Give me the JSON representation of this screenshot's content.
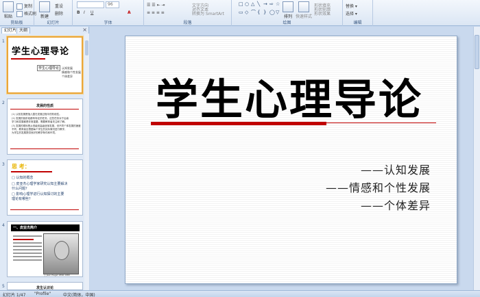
{
  "ribbon": {
    "clipboard": {
      "label": "剪贴板",
      "paste": "粘贴",
      "copy": "复制",
      "format_painter": "格式刷"
    },
    "slides": {
      "label": "幻灯片",
      "new_slide": "新建",
      "new_slide_sub": "幻灯片",
      "reset": "重设",
      "delete": "删除"
    },
    "font": {
      "label": "字体",
      "size": "96"
    },
    "paragraph": {
      "label": "段落",
      "text_direction": "文字方向",
      "align_text": "对齐文本",
      "smartart": "转换为 SmartArt"
    },
    "drawing": {
      "label": "绘图",
      "arrange": "排列",
      "quick_styles": "快速样式",
      "shape_fill": "形状填充",
      "shape_outline": "形状轮廓",
      "shape_effects": "形状效果"
    },
    "editing": {
      "label": "编辑",
      "replace": "替换",
      "select": "选择"
    }
  },
  "leftpane": {
    "tabs": [
      "幻灯片",
      "大纲"
    ],
    "slides": [
      {
        "num": "1",
        "title": "学生心理导论",
        "box": "学生心理导论",
        "items": [
          "认知发展",
          "情感和个性发展",
          "个体差异"
        ]
      },
      {
        "num": "2",
        "title": "发展的性质",
        "lines": [
          "(1) 认知发展是指儿童在发展过程中的阶段性。",
          "(2) 发展的各阶段都有特定的任务，这些任务对于后续",
          "    学习和发展都是非常重要，需要教育者关注和了解。",
          "(3) 发展的顺序是从低级到高级逐渐发展，但不同个体发展的速度",
          "    不同，教育者应根据每个学生的实际情况进行教学，",
          "    为学生的发展提供良好的教学条件和环境。"
        ]
      },
      {
        "num": "3",
        "head": "思 考：",
        "items": [
          "□ 认知的概念",
          "□ 皮亚杰心理学家研究认知主要解决",
          "      什么问题？",
          "□ 影响心理学进行认知探讨的主要",
          "      理论有哪些？"
        ]
      },
      {
        "num": "4",
        "band": "一、皮亚杰简介",
        "caption": "J. Jean Piaget  1896-1980"
      },
      {
        "num": "5",
        "title": "发生认识论"
      }
    ]
  },
  "slide": {
    "title": "学生心理导论",
    "subtitles": [
      "——认知发展",
      "——情感和个性发展",
      "——个体差异"
    ]
  },
  "status": {
    "slide_info": "幻灯片 1/47",
    "theme": "\"Profile\"",
    "language": "中文(简体，中国)"
  },
  "colors": {
    "accent_red": "#c00000",
    "ribbon_blue": "#dbe6f4",
    "selection_orange": "#e9a63a"
  }
}
